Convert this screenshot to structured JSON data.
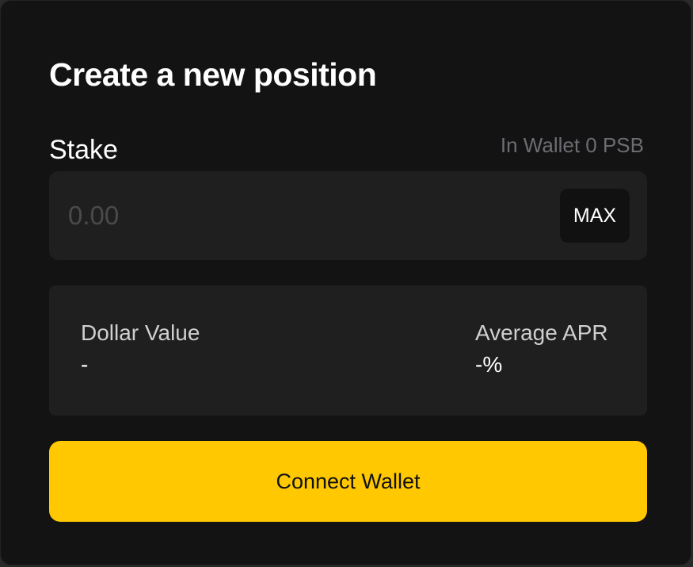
{
  "title": "Create a new position",
  "stake": {
    "label": "Stake",
    "wallet_balance": "In Wallet 0 PSB",
    "input_placeholder": "0.00",
    "input_value": "",
    "max_label": "MAX"
  },
  "info": {
    "dollar_value_label": "Dollar Value",
    "dollar_value": "-",
    "apr_label": "Average APR",
    "apr_value": "-%"
  },
  "connect_button_label": "Connect Wallet",
  "colors": {
    "accent": "#ffc800",
    "card_background": "#131313",
    "panel_background": "#1f1f1f",
    "muted_text": "#6c6c72"
  }
}
